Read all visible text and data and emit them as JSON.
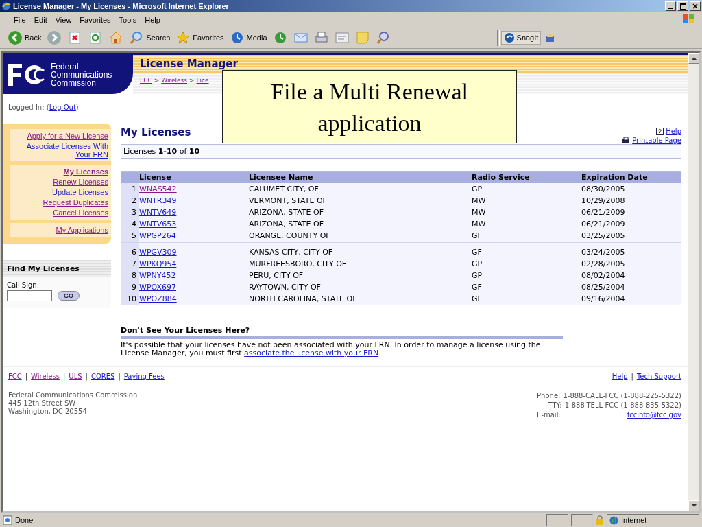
{
  "window": {
    "title": "License Manager - My Licenses - Microsoft Internet Explorer"
  },
  "menu": [
    "File",
    "Edit",
    "View",
    "Favorites",
    "Tools",
    "Help"
  ],
  "toolbar": [
    {
      "kind": "back",
      "label": "Back"
    },
    {
      "kind": "forward"
    },
    {
      "kind": "stop"
    },
    {
      "kind": "refresh"
    },
    {
      "kind": "home"
    },
    {
      "kind": "search",
      "label": "Search"
    },
    {
      "kind": "favorites",
      "label": "Favorites"
    },
    {
      "kind": "media",
      "label": "Media"
    },
    {
      "kind": "history"
    },
    {
      "kind": "mail"
    },
    {
      "kind": "print"
    },
    {
      "kind": "edit"
    },
    {
      "kind": "note"
    },
    {
      "kind": "research"
    }
  ],
  "snagit": {
    "label": "SnagIt"
  },
  "header": {
    "org": [
      "Federal",
      "Communications",
      "Commission"
    ],
    "app_title": "License Manager",
    "breadcrumb_separator": ">",
    "breadcrumb": [
      {
        "label": "FCC",
        "visited": true
      },
      {
        "label": "Wireless",
        "visited": true
      },
      {
        "label": "Lice",
        "visited": true
      }
    ]
  },
  "logged_in": {
    "label": "Logged In:",
    "open": "(",
    "link": "Log Out",
    "close": ")"
  },
  "sidebar": {
    "groups": [
      [
        {
          "label": "Apply for a New License",
          "visited": true,
          "selected": false
        },
        {
          "label": "Associate Licenses With Your FRN",
          "visited": false,
          "selected": false
        }
      ],
      [
        {
          "label": "My Licenses",
          "visited": true,
          "selected": true
        },
        {
          "label": "Renew Licenses",
          "visited": true,
          "selected": false
        },
        {
          "label": "Update Licenses",
          "visited": false,
          "selected": false
        },
        {
          "label": "Request Duplicates",
          "visited": true,
          "selected": false
        },
        {
          "label": "Cancel Licenses",
          "visited": true,
          "selected": false
        }
      ],
      [
        {
          "label": "My Applications",
          "visited": true,
          "selected": false
        }
      ]
    ],
    "find": {
      "title": "Find My Licenses",
      "field_label": "Call Sign:",
      "button": "GO"
    }
  },
  "page_title": "My Licenses",
  "help": "Help",
  "printable": "Printable Page",
  "summary": "Licenses  **1-10** of **10**",
  "table": {
    "columns": [
      "License",
      "Licensee Name",
      "Radio Service",
      "Expiration Date"
    ],
    "row_groups": [
      [
        {
          "num": "1",
          "license": "WNAS542",
          "visited": true,
          "name": "CALUMET CITY, OF",
          "service": "GP",
          "expiration": "08/30/2005"
        },
        {
          "num": "2",
          "license": "WNTR349",
          "visited": false,
          "name": "VERMONT, STATE OF",
          "service": "MW",
          "expiration": "10/29/2008"
        },
        {
          "num": "3",
          "license": "WNTV649",
          "visited": false,
          "name": "ARIZONA, STATE OF",
          "service": "MW",
          "expiration": "06/21/2009"
        },
        {
          "num": "4",
          "license": "WNTV653",
          "visited": false,
          "name": "ARIZONA, STATE OF",
          "service": "MW",
          "expiration": "06/21/2009"
        },
        {
          "num": "5",
          "license": "WPGP264",
          "visited": false,
          "name": "ORANGE, COUNTY OF",
          "service": "GF",
          "expiration": "03/25/2005"
        }
      ],
      [
        {
          "num": "6",
          "license": "WPGV309",
          "visited": false,
          "name": "KANSAS CITY, CITY OF",
          "service": "GF",
          "expiration": "03/24/2005"
        },
        {
          "num": "7",
          "license": "WPKQ954",
          "visited": false,
          "name": "MURFREESBORO, CITY OF",
          "service": "GP",
          "expiration": "02/28/2005"
        },
        {
          "num": "8",
          "license": "WPNY452",
          "visited": false,
          "name": "PERU, CITY OF",
          "service": "GP",
          "expiration": "08/02/2004"
        },
        {
          "num": "9",
          "license": "WPOX697",
          "visited": false,
          "name": "RAYTOWN, CITY OF",
          "service": "GF",
          "expiration": "08/25/2004"
        },
        {
          "num": "10",
          "license": "WPOZ884",
          "visited": false,
          "name": "NORTH CAROLINA, STATE OF",
          "service": "GF",
          "expiration": "09/16/2004"
        }
      ]
    ]
  },
  "notice": {
    "title": "Don't See Your Licenses Here?",
    "text_before": "It's possible that your licenses have not been associated with your FRN. In order to manage a license using the License Manager, you must first",
    "link": "associate the license with your FRN",
    "text_after": "."
  },
  "footer": {
    "separator": "|",
    "links": [
      {
        "label": "FCC",
        "visited": true
      },
      {
        "label": "Wireless",
        "visited": true
      },
      {
        "label": "ULS",
        "visited": true
      },
      {
        "label": "CORES",
        "visited": false
      },
      {
        "label": "Paying Fees",
        "visited": false
      }
    ],
    "right_links": [
      {
        "label": "Help",
        "visited": false
      },
      {
        "label": "Tech Support",
        "visited": false
      }
    ],
    "address": [
      "Federal Communications Commission",
      "445 12th Street SW",
      "Washington, DC 20554"
    ],
    "contacts": [
      {
        "label": "Phone:",
        "value": "1-888-CALL-FCC (1-888-225-5322)"
      },
      {
        "label": "TTY:",
        "value": "1-888-TELL-FCC (1-888-835-5322)"
      }
    ],
    "email": {
      "label": "E-mail:",
      "link": "fccinfo@fcc.gov"
    }
  },
  "callout": {
    "text": "File a Multi Renewal application"
  },
  "status_bar": {
    "text": "Done",
    "zone": "Internet"
  }
}
